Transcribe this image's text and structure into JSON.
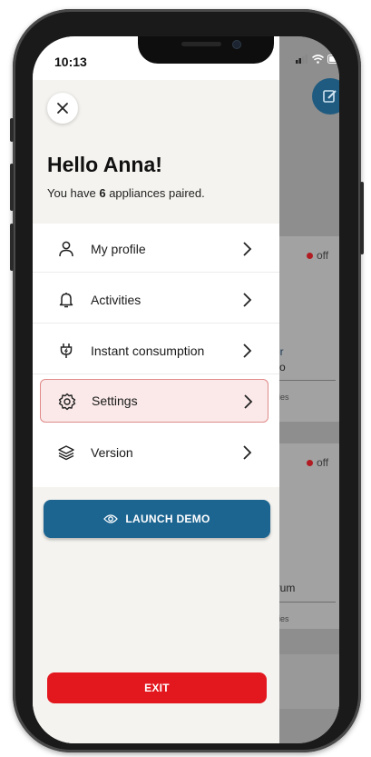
{
  "status_bar": {
    "time": "10:13",
    "icons": [
      "signal-icon",
      "wifi-icon",
      "battery-icon"
    ]
  },
  "drawer": {
    "close_icon": "close-icon",
    "greeting": "Hello Anna!",
    "subtitle_prefix": "You have ",
    "appliance_count": "6",
    "subtitle_suffix": " appliances paired.",
    "menu": [
      {
        "label": "My profile",
        "icon": "user-icon",
        "active": false
      },
      {
        "label": "Activities",
        "icon": "bell-icon",
        "active": false
      },
      {
        "label": "Instant consumption",
        "icon": "plug-icon",
        "active": false
      },
      {
        "label": "Settings",
        "icon": "gear-icon",
        "active": true
      },
      {
        "label": "Version",
        "icon": "layers-icon",
        "active": false
      }
    ],
    "demo_button": "LAUNCH DEMO",
    "exit_button": "EXIT"
  },
  "background_app": {
    "cards": [
      {
        "status": "off",
        "name_partial": "ver",
        "model_partial": "Pro",
        "link_partial": "vities"
      },
      {
        "status": "off",
        "name_partial": "er",
        "model_partial": "Drum",
        "link_partial": "vities"
      }
    ]
  },
  "colors": {
    "accent_blue": "#1c6591",
    "exit_red": "#e3171e",
    "active_bg": "#fbe9e9",
    "active_border": "#e08a8a",
    "status_off": "#b01c22",
    "header_bg": "#f4f3ef"
  }
}
